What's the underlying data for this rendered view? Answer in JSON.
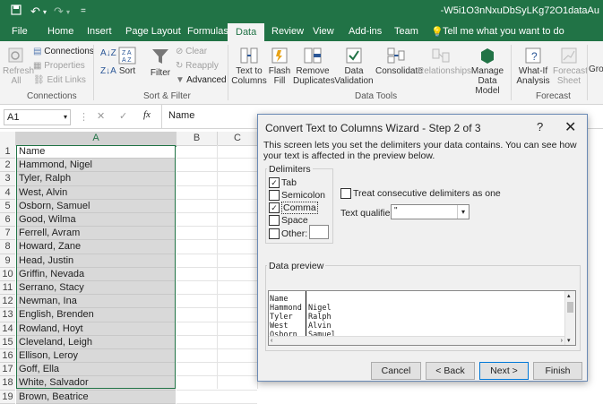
{
  "title_bar": {
    "doc_title": "-W5i1O3nNxuDbSyLKg72O1dataAu",
    "save_icon": "save-icon",
    "undo_icon": "undo-icon"
  },
  "tabs": [
    "File",
    "Home",
    "Insert",
    "Page Layout",
    "Formulas",
    "Data",
    "Review",
    "View",
    "Add-ins",
    "Team"
  ],
  "tell_me": "Tell me what you want to do",
  "ribbon": {
    "refresh": "Refresh All",
    "connections": "Connections",
    "properties": "Properties",
    "edit_links": "Edit Links",
    "group_connections": "Connections",
    "sort": "Sort",
    "filter": "Filter",
    "clear": "Clear",
    "reapply": "Reapply",
    "advanced": "Advanced",
    "group_sort_filter": "Sort & Filter",
    "text_to_columns_1": "Text to",
    "text_to_columns_2": "Columns",
    "flash_fill_1": "Flash",
    "flash_fill_2": "Fill",
    "remove_dup_1": "Remove",
    "remove_dup_2": "Duplicates",
    "data_val_1": "Data",
    "data_val_2": "Validation",
    "consolidate": "Consolidate",
    "relationships": "Relationships",
    "manage_1": "Manage",
    "manage_2": "Data Model",
    "group_data_tools": "Data Tools",
    "whatif_1": "What-If",
    "whatif_2": "Analysis",
    "forecast_1": "Forecast",
    "forecast_2": "Sheet",
    "group_forecast": "Forecast",
    "group_cut": "Gro"
  },
  "formula_bar": {
    "name_box": "A1",
    "cancel": "✕",
    "enter": "✓",
    "fx": "fx",
    "content": "Name"
  },
  "columns": [
    "A",
    "B",
    "C"
  ],
  "rows": [
    {
      "n": "1",
      "v": "Name"
    },
    {
      "n": "2",
      "v": "Hammond, Nigel"
    },
    {
      "n": "3",
      "v": "Tyler, Ralph"
    },
    {
      "n": "4",
      "v": "West, Alvin"
    },
    {
      "n": "5",
      "v": "Osborn, Samuel"
    },
    {
      "n": "6",
      "v": "Good, Wilma"
    },
    {
      "n": "7",
      "v": "Ferrell, Avram"
    },
    {
      "n": "8",
      "v": "Howard, Zane"
    },
    {
      "n": "9",
      "v": "Head, Justin"
    },
    {
      "n": "10",
      "v": "Griffin, Nevada"
    },
    {
      "n": "11",
      "v": "Serrano, Stacy"
    },
    {
      "n": "12",
      "v": "Newman, Ina"
    },
    {
      "n": "13",
      "v": "English, Brenden"
    },
    {
      "n": "14",
      "v": "Rowland, Hoyt"
    },
    {
      "n": "15",
      "v": "Cleveland, Leigh"
    },
    {
      "n": "16",
      "v": "Ellison, Leroy"
    },
    {
      "n": "17",
      "v": "Goff, Ella"
    },
    {
      "n": "18",
      "v": "White, Salvador"
    },
    {
      "n": "19",
      "v": "Brown, Beatrice"
    }
  ],
  "dialog": {
    "title": "Convert Text to Columns Wizard - Step 2 of 3",
    "help": "?",
    "close": "✕",
    "description": "This screen lets you set the delimiters your data contains.  You can see how your text is affected in the preview below.",
    "delimiters_label": "Delimiters",
    "tab": {
      "label": "Tab",
      "checked": true
    },
    "semicolon": {
      "label": "Semicolon",
      "checked": false
    },
    "comma": {
      "label": "Comma",
      "checked": true
    },
    "space": {
      "label": "Space",
      "checked": false
    },
    "other": {
      "label": "Other:",
      "checked": false,
      "value": ""
    },
    "treat_consecutive": {
      "label": "Treat consecutive delimiters as one",
      "checked": false
    },
    "text_qualifier_label": "Text qualifier:",
    "text_qualifier_value": "\"",
    "data_preview_label": "Data preview",
    "preview_rows": [
      [
        "Name",
        ""
      ],
      [
        "Hammond",
        "Nigel"
      ],
      [
        "Tyler",
        "Ralph"
      ],
      [
        "West",
        "Alvin"
      ],
      [
        "Osborn",
        "Samuel"
      ]
    ],
    "buttons": {
      "cancel": "Cancel",
      "back": "< Back",
      "next": "Next >",
      "finish": "Finish"
    }
  }
}
